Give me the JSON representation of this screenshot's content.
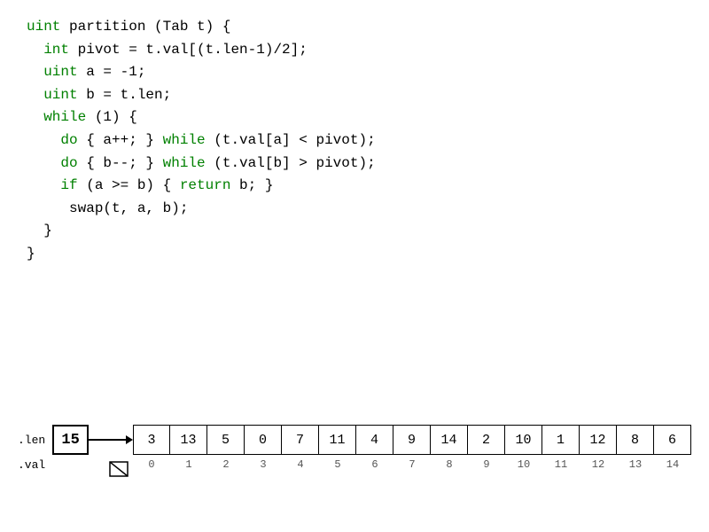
{
  "code": {
    "lines": [
      {
        "id": "l1",
        "segments": [
          {
            "text": "uint ",
            "color": "kw"
          },
          {
            "text": "partition (Tab t) {",
            "color": "plain"
          }
        ]
      },
      {
        "id": "l2",
        "segments": [
          {
            "text": "  int ",
            "color": "kw"
          },
          {
            "text": "pivot = t.val[(t.len-1)/2];",
            "color": "plain"
          }
        ]
      },
      {
        "id": "l3",
        "segments": [
          {
            "text": "  uint ",
            "color": "kw"
          },
          {
            "text": "a = -1;",
            "color": "plain"
          }
        ]
      },
      {
        "id": "l4",
        "segments": [
          {
            "text": "  uint ",
            "color": "kw"
          },
          {
            "text": "b = t.len;",
            "color": "plain"
          }
        ]
      },
      {
        "id": "l5",
        "segments": [
          {
            "text": "  while",
            "color": "kw"
          },
          {
            "text": " (1) {",
            "color": "plain"
          }
        ]
      },
      {
        "id": "l6",
        "segments": [
          {
            "text": "    do",
            "color": "kw"
          },
          {
            "text": " { a++; } ",
            "color": "plain"
          },
          {
            "text": "while",
            "color": "kw"
          },
          {
            "text": " (t.val[a] < pivot);",
            "color": "plain"
          }
        ]
      },
      {
        "id": "l7",
        "segments": [
          {
            "text": "    do",
            "color": "kw"
          },
          {
            "text": " { b--; } ",
            "color": "plain"
          },
          {
            "text": "while",
            "color": "kw"
          },
          {
            "text": " (t.val[b] > pivot);",
            "color": "plain"
          }
        ]
      },
      {
        "id": "l8",
        "segments": [
          {
            "text": "    if",
            "color": "kw"
          },
          {
            "text": " (a >= b) { ",
            "color": "plain"
          },
          {
            "text": "return",
            "color": "kw"
          },
          {
            "text": " b; }",
            "color": "plain"
          }
        ]
      },
      {
        "id": "l9",
        "segments": [
          {
            "text": "     swap(t, a, b);",
            "color": "plain"
          }
        ]
      },
      {
        "id": "l10",
        "segments": [
          {
            "text": "  }",
            "color": "plain"
          }
        ]
      },
      {
        "id": "l11",
        "segments": [
          {
            "text": "}",
            "color": "plain"
          }
        ]
      }
    ]
  },
  "viz": {
    "len_label": ".len",
    "val_label": ".val",
    "len_value": "15",
    "array_values": [
      3,
      13,
      5,
      0,
      7,
      11,
      4,
      9,
      14,
      2,
      10,
      1,
      12,
      8,
      6
    ],
    "array_indices": [
      0,
      1,
      2,
      3,
      4,
      5,
      6,
      7,
      8,
      9,
      10,
      11,
      12,
      13,
      14
    ]
  }
}
